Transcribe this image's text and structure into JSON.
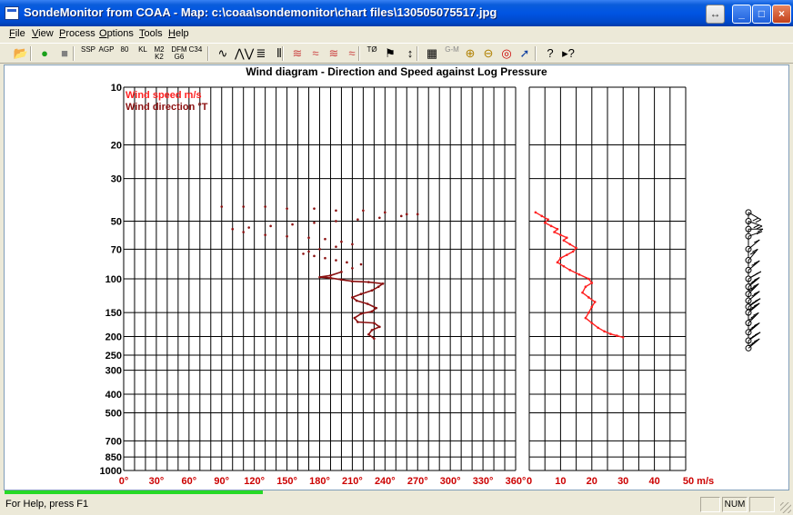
{
  "window": {
    "title": "SondeMonitor from COAA - Map: c:\\coaa\\sondemonitor\\chart files\\130505075517.jpg",
    "controls": {
      "restore": "↔",
      "minimize": "_",
      "maximize": "□",
      "close": "×"
    }
  },
  "menu": [
    "File",
    "View",
    "Process",
    "Options",
    "Tools",
    "Help"
  ],
  "toolbar": {
    "buttons": [
      {
        "name": "open-icon",
        "label": "📂",
        "kind": "icon"
      },
      {
        "name": "start-icon",
        "label": "●",
        "kind": "icon"
      },
      {
        "name": "stop-icon",
        "label": "■",
        "kind": "icon"
      },
      {
        "name": "rs-ssp-button",
        "label": "SSP",
        "kind": "text"
      },
      {
        "name": "rs-agp-button",
        "label": "AGP",
        "kind": "text"
      },
      {
        "name": "rs-80-button",
        "label": "80",
        "kind": "text"
      },
      {
        "name": "rs-kl-button",
        "label": "KL",
        "kind": "text"
      },
      {
        "name": "m2-k2-button",
        "label": "M2 K2",
        "kind": "text"
      },
      {
        "name": "dfm-g6-button",
        "label": "DFM G6",
        "kind": "text"
      },
      {
        "name": "c34-button",
        "label": "C34",
        "kind": "text"
      },
      {
        "name": "wave1-icon",
        "label": "∿",
        "kind": "icon"
      },
      {
        "name": "wave2-icon",
        "label": "⋀⋁",
        "kind": "icon"
      },
      {
        "name": "lines-icon",
        "label": "≣",
        "kind": "icon"
      },
      {
        "name": "bars-icon",
        "label": "⦀",
        "kind": "icon"
      },
      {
        "name": "graph1-icon",
        "label": "≋",
        "kind": "icon"
      },
      {
        "name": "graph2-icon",
        "label": "≈",
        "kind": "icon"
      },
      {
        "name": "graph3-icon",
        "label": "≋",
        "kind": "icon"
      },
      {
        "name": "graph4-icon",
        "label": "≈",
        "kind": "icon"
      },
      {
        "name": "t-phi-button",
        "label": "TØ",
        "kind": "text"
      },
      {
        "name": "wind-flag-icon",
        "label": "⚑",
        "kind": "icon"
      },
      {
        "name": "updown-icon",
        "label": "↕",
        "kind": "icon"
      },
      {
        "name": "map-icon",
        "label": "▦",
        "kind": "icon"
      },
      {
        "name": "gm-button",
        "label": "G-M",
        "kind": "text"
      },
      {
        "name": "zoom-in-icon",
        "label": "⊕",
        "kind": "icon"
      },
      {
        "name": "zoom-out-icon",
        "label": "⊖",
        "kind": "icon"
      },
      {
        "name": "target-icon",
        "label": "◎",
        "kind": "icon"
      },
      {
        "name": "compass-icon",
        "label": "➚",
        "kind": "icon"
      },
      {
        "name": "help-icon",
        "label": "?",
        "kind": "icon"
      },
      {
        "name": "context-help-icon",
        "label": "▸?",
        "kind": "icon"
      }
    ]
  },
  "colors": {
    "direction": "#8b1010",
    "speed": "#ff2020",
    "grid": "#000000",
    "axis_text_red": "#cc0000"
  },
  "chart_data": {
    "type": "scatter",
    "title": "Wind diagram - Direction and Speed against Log Pressure",
    "legend": [
      "Wind speed m/s",
      "Wind direction °T"
    ],
    "legend_colors": [
      "#ff2020",
      "#8b1010"
    ],
    "legend_placement": "top-left",
    "y_axis": {
      "scale": "log",
      "reversed": true,
      "range": [
        10,
        1000
      ],
      "ticks": [
        10,
        20,
        30,
        50,
        70,
        100,
        150,
        200,
        250,
        300,
        400,
        500,
        700,
        850,
        1000
      ]
    },
    "direction_axis": {
      "range": [
        0,
        360
      ],
      "ticks": [
        "0°",
        "30°",
        "60°",
        "90°",
        "120°",
        "150°",
        "180°",
        "210°",
        "240°",
        "270°",
        "300°",
        "330°",
        "360°"
      ],
      "minor_step": 10
    },
    "speed_axis": {
      "range": [
        0,
        50
      ],
      "ticks": [
        "0",
        "10",
        "20",
        "30",
        "40",
        "50 m/s"
      ],
      "minor_step": 5
    },
    "grid": true,
    "series": [
      {
        "name": "Wind direction °T",
        "points": [
          [
            230,
            205
          ],
          [
            225,
            195
          ],
          [
            228,
            185
          ],
          [
            235,
            178
          ],
          [
            230,
            170
          ],
          [
            215,
            168
          ],
          [
            212,
            160
          ],
          [
            218,
            152
          ],
          [
            228,
            148
          ],
          [
            232,
            142
          ],
          [
            224,
            135
          ],
          [
            214,
            130
          ],
          [
            210,
            125
          ],
          [
            218,
            120
          ],
          [
            228,
            115
          ],
          [
            234,
            110
          ],
          [
            238,
            106
          ],
          [
            225,
            104
          ],
          [
            210,
            103
          ],
          [
            200,
            101
          ],
          [
            190,
            99
          ],
          [
            180,
            98
          ],
          [
            190,
            96
          ],
          [
            200,
            92
          ],
          [
            210,
            88
          ],
          [
            218,
            84
          ],
          [
            205,
            82
          ],
          [
            195,
            80
          ],
          [
            185,
            78
          ],
          [
            175,
            76
          ],
          [
            165,
            74
          ],
          [
            170,
            72
          ],
          [
            180,
            70
          ],
          [
            195,
            68
          ],
          [
            210,
            66
          ],
          [
            200,
            64
          ],
          [
            185,
            62
          ],
          [
            170,
            61
          ],
          [
            150,
            60
          ],
          [
            130,
            59
          ],
          [
            110,
            57
          ],
          [
            100,
            55
          ],
          [
            115,
            54
          ],
          [
            135,
            53
          ],
          [
            155,
            52
          ],
          [
            175,
            51
          ],
          [
            195,
            50
          ],
          [
            215,
            49
          ],
          [
            235,
            48
          ],
          [
            255,
            47
          ],
          [
            270,
            46
          ],
          [
            260,
            46
          ],
          [
            240,
            45
          ],
          [
            220,
            44
          ],
          [
            195,
            44
          ],
          [
            175,
            43
          ],
          [
            150,
            43
          ],
          [
            130,
            42
          ],
          [
            110,
            42
          ],
          [
            90,
            42
          ]
        ]
      },
      {
        "name": "Wind speed m/s",
        "points": [
          [
            2,
            45
          ],
          [
            4,
            47
          ],
          [
            6,
            49
          ],
          [
            5,
            51
          ],
          [
            7,
            53
          ],
          [
            9,
            55
          ],
          [
            8,
            57
          ],
          [
            10,
            59
          ],
          [
            12,
            61
          ],
          [
            11,
            63
          ],
          [
            13,
            66
          ],
          [
            15,
            69
          ],
          [
            14,
            72
          ],
          [
            12,
            75
          ],
          [
            10,
            78
          ],
          [
            9,
            82
          ],
          [
            11,
            86
          ],
          [
            13,
            90
          ],
          [
            16,
            95
          ],
          [
            19,
            100
          ],
          [
            20,
            105
          ],
          [
            18,
            110
          ],
          [
            17,
            118
          ],
          [
            19,
            125
          ],
          [
            21,
            132
          ],
          [
            20,
            140
          ],
          [
            19,
            150
          ],
          [
            18,
            160
          ],
          [
            20,
            170
          ],
          [
            22,
            180
          ],
          [
            24,
            188
          ],
          [
            26,
            194
          ],
          [
            28,
            198
          ],
          [
            30,
            202
          ]
        ]
      }
    ],
    "wind_barbs": [
      {
        "pressure": 45,
        "speed_ms": 18,
        "direction": 300
      },
      {
        "pressure": 50,
        "speed_ms": 12,
        "direction": 290
      },
      {
        "pressure": 55,
        "speed_ms": 8,
        "direction": 270
      },
      {
        "pressure": 60,
        "speed_ms": 6,
        "direction": 250
      },
      {
        "pressure": 70,
        "speed_ms": 10,
        "direction": 230
      },
      {
        "pressure": 80,
        "speed_ms": 14,
        "direction": 220
      },
      {
        "pressure": 90,
        "speed_ms": 16,
        "direction": 230
      },
      {
        "pressure": 100,
        "speed_ms": 20,
        "direction": 240
      },
      {
        "pressure": 110,
        "speed_ms": 22,
        "direction": 230
      },
      {
        "pressure": 120,
        "speed_ms": 20,
        "direction": 225
      },
      {
        "pressure": 130,
        "speed_ms": 18,
        "direction": 230
      },
      {
        "pressure": 140,
        "speed_ms": 20,
        "direction": 235
      },
      {
        "pressure": 150,
        "speed_ms": 22,
        "direction": 230
      },
      {
        "pressure": 170,
        "speed_ms": 24,
        "direction": 225
      },
      {
        "pressure": 190,
        "speed_ms": 26,
        "direction": 230
      },
      {
        "pressure": 210,
        "speed_ms": 28,
        "direction": 235
      },
      {
        "pressure": 230,
        "speed_ms": 26,
        "direction": 230
      }
    ]
  },
  "statusbar": {
    "text": "For Help, press F1",
    "pane1": "",
    "num": "NUM",
    "pane3": ""
  },
  "progress": {
    "fraction": 0.33
  }
}
